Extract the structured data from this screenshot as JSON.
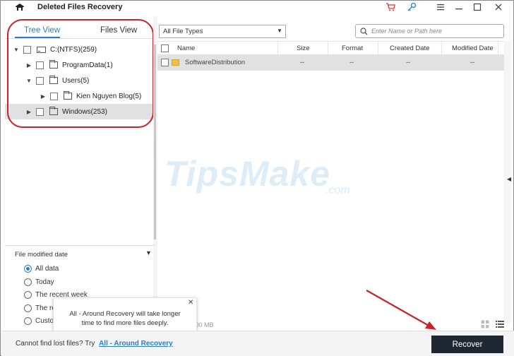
{
  "window": {
    "title": "Deleted Files Recovery",
    "controls": [
      "cart-icon",
      "key-icon",
      "menu-icon",
      "minimize-icon",
      "maximize-icon",
      "close-icon"
    ]
  },
  "left_panel": {
    "tabs": [
      {
        "label": "Tree View",
        "active": true
      },
      {
        "label": "Files View",
        "active": false
      }
    ],
    "tree": [
      {
        "label": "C:(NTFS)(259)",
        "expanded": true,
        "selected": false
      },
      {
        "label": "ProgramData(1)",
        "expanded": false,
        "selected": false
      },
      {
        "label": "Users(5)",
        "expanded": true,
        "selected": false
      },
      {
        "label": "Kien Nguyen Blog(5)",
        "expanded": false,
        "selected": false
      },
      {
        "label": "Windows(253)",
        "expanded": false,
        "selected": true
      }
    ],
    "filter": {
      "title": "File modified date",
      "options": [
        {
          "label": "All data",
          "selected": true
        },
        {
          "label": "Today",
          "selected": false
        },
        {
          "label": "The recent week",
          "selected": false
        },
        {
          "label": "The re",
          "selected": false
        },
        {
          "label": "Custo",
          "selected": false
        }
      ]
    },
    "tooltip": {
      "line1": "All - Around Recovery will take longer",
      "line2": "time to find more files deeply."
    }
  },
  "toolbar": {
    "file_type": "All File Types",
    "search_placeholder": "Enter Name or Path here"
  },
  "grid": {
    "columns": [
      "Name",
      "Size",
      "Format",
      "Created Date",
      "Modified Date"
    ],
    "rows": [
      {
        "name": "SoftwareDistribution",
        "size": "--",
        "format": "--",
        "created": "--",
        "modified": "--"
      }
    ]
  },
  "watermark": {
    "brand": "TipsMake",
    "tld": ".com"
  },
  "status": {
    "size": "0.00 MB"
  },
  "bottom": {
    "prompt": "Cannot find lost files? Try",
    "link": "All - Around Recovery",
    "recover_label": "Recover"
  },
  "colors": {
    "accent": "#2b7fc0",
    "annotation_red": "#cc2127",
    "recover_button": "#1f2733"
  }
}
